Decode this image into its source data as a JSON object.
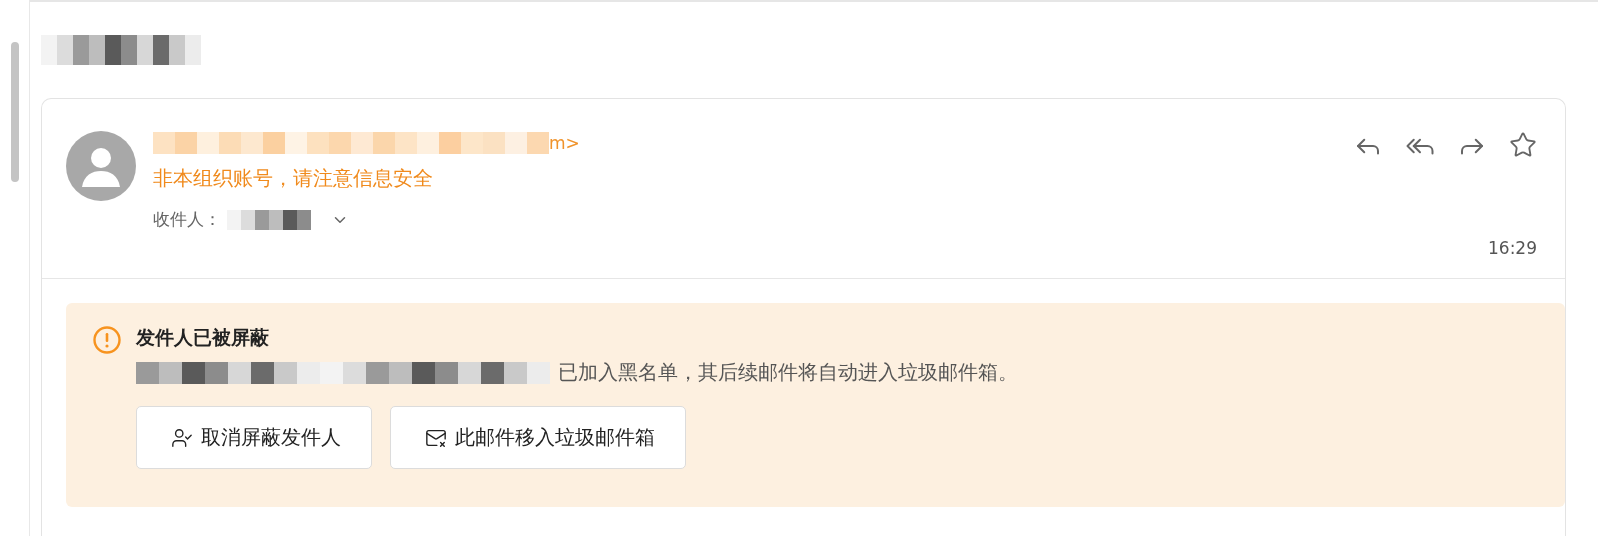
{
  "sender": {
    "visible_tail": "m>",
    "warning": "非本组织账号，请注意信息安全"
  },
  "recipients": {
    "label": "收件人："
  },
  "time": "16:29",
  "alert": {
    "title": "发件人已被屏蔽",
    "message": "已加入黑名单，其后续邮件将自动进入垃圾邮件箱。",
    "buttons": [
      {
        "kind": "unblock",
        "label": "取消屏蔽发件人"
      },
      {
        "kind": "spam",
        "label": "此邮件移入垃圾邮件箱"
      }
    ]
  }
}
